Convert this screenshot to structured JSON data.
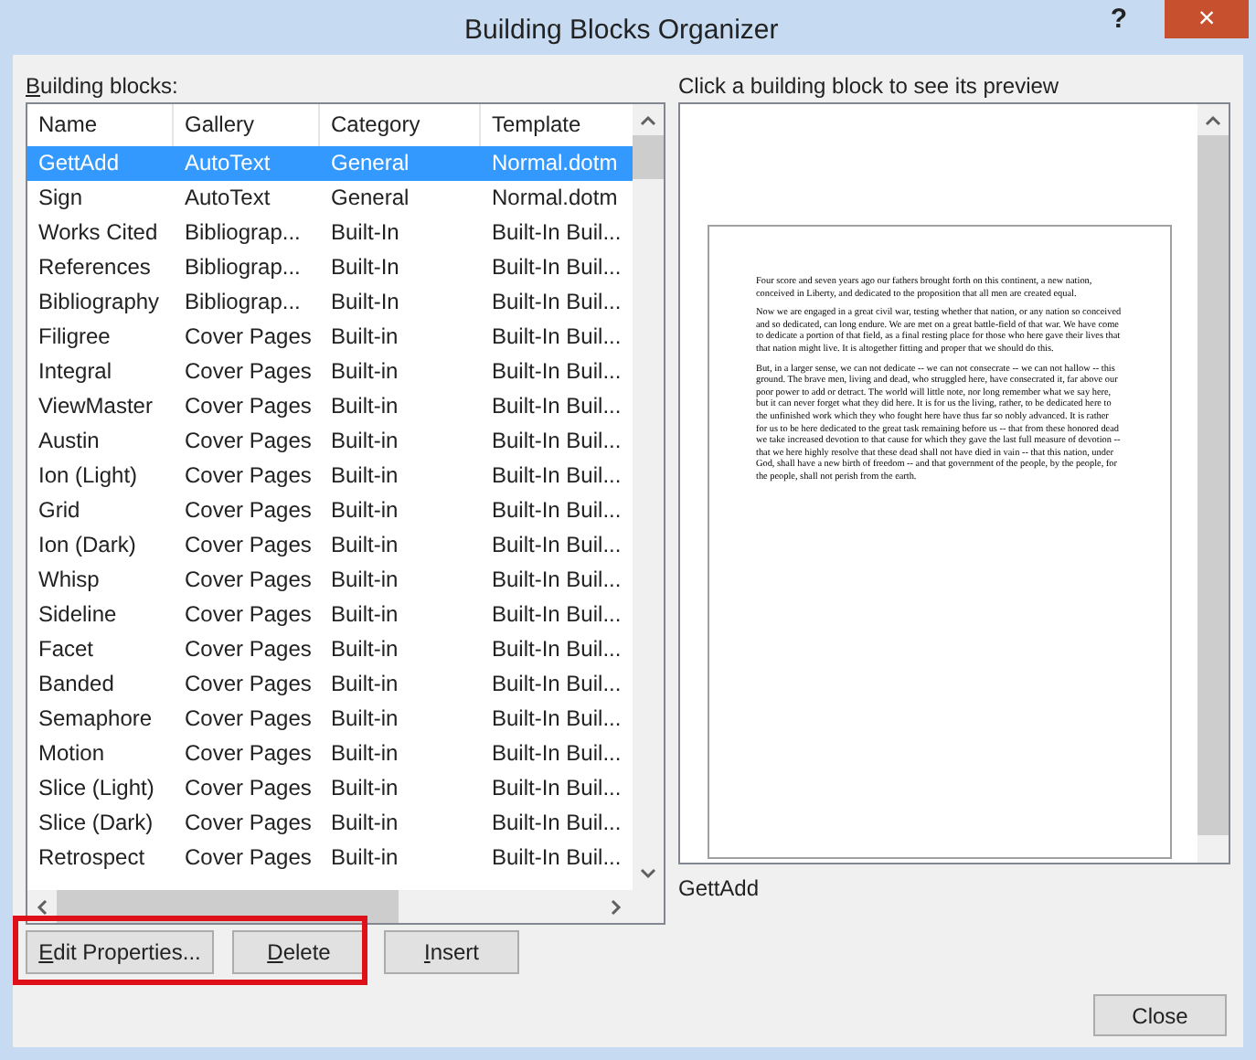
{
  "window": {
    "title": "Building Blocks Organizer",
    "help": "?",
    "close": "×"
  },
  "list_label": "Building blocks:",
  "table": {
    "columns": [
      "Name",
      "Gallery",
      "Category",
      "Template"
    ],
    "rows": [
      {
        "name": "GettAdd",
        "gallery": "AutoText",
        "category": "General",
        "template": "Normal.dotm",
        "selected": true
      },
      {
        "name": "Sign",
        "gallery": "AutoText",
        "category": "General",
        "template": "Normal.dotm",
        "selected": false
      },
      {
        "name": "Works Cited",
        "gallery": "Bibliograp...",
        "category": "Built-In",
        "template": "Built-In Buil...",
        "selected": false
      },
      {
        "name": "References",
        "gallery": "Bibliograp...",
        "category": "Built-In",
        "template": "Built-In Buil...",
        "selected": false
      },
      {
        "name": "Bibliography",
        "gallery": "Bibliograp...",
        "category": "Built-In",
        "template": "Built-In Buil...",
        "selected": false
      },
      {
        "name": "Filigree",
        "gallery": "Cover Pages",
        "category": "Built-in",
        "template": "Built-In Buil...",
        "selected": false
      },
      {
        "name": "Integral",
        "gallery": "Cover Pages",
        "category": "Built-in",
        "template": "Built-In Buil...",
        "selected": false
      },
      {
        "name": "ViewMaster",
        "gallery": "Cover Pages",
        "category": "Built-in",
        "template": "Built-In Buil...",
        "selected": false
      },
      {
        "name": "Austin",
        "gallery": "Cover Pages",
        "category": "Built-in",
        "template": "Built-In Buil...",
        "selected": false
      },
      {
        "name": "Ion (Light)",
        "gallery": "Cover Pages",
        "category": "Built-in",
        "template": "Built-In Buil...",
        "selected": false
      },
      {
        "name": "Grid",
        "gallery": "Cover Pages",
        "category": "Built-in",
        "template": "Built-In Buil...",
        "selected": false
      },
      {
        "name": "Ion (Dark)",
        "gallery": "Cover Pages",
        "category": "Built-in",
        "template": "Built-In Buil...",
        "selected": false
      },
      {
        "name": "Whisp",
        "gallery": "Cover Pages",
        "category": "Built-in",
        "template": "Built-In Buil...",
        "selected": false
      },
      {
        "name": "Sideline",
        "gallery": "Cover Pages",
        "category": "Built-in",
        "template": "Built-In Buil...",
        "selected": false
      },
      {
        "name": "Facet",
        "gallery": "Cover Pages",
        "category": "Built-in",
        "template": "Built-In Buil...",
        "selected": false
      },
      {
        "name": "Banded",
        "gallery": "Cover Pages",
        "category": "Built-in",
        "template": "Built-In Buil...",
        "selected": false
      },
      {
        "name": "Semaphore",
        "gallery": "Cover Pages",
        "category": "Built-in",
        "template": "Built-In Buil...",
        "selected": false
      },
      {
        "name": "Motion",
        "gallery": "Cover Pages",
        "category": "Built-in",
        "template": "Built-In Buil...",
        "selected": false
      },
      {
        "name": "Slice (Light)",
        "gallery": "Cover Pages",
        "category": "Built-in",
        "template": "Built-In Buil...",
        "selected": false
      },
      {
        "name": "Slice (Dark)",
        "gallery": "Cover Pages",
        "category": "Built-in",
        "template": "Built-In Buil...",
        "selected": false
      },
      {
        "name": "Retrospect",
        "gallery": "Cover Pages",
        "category": "Built-in",
        "template": "Built-In Buil...",
        "selected": false
      }
    ]
  },
  "buttons": [
    {
      "label": "Edit Properties...",
      "highlighted": true
    },
    {
      "label": "Delete",
      "highlighted": true
    },
    {
      "label": "Insert",
      "highlighted": false
    }
  ],
  "preview": {
    "label": "Click a building block to see its preview",
    "paragraphs": [
      "Four score and seven years ago our fathers brought forth on this continent, a new nation, conceived in Liberty, and dedicated to the proposition that all men are created equal.",
      "Now we are engaged in a great civil war, testing whether that nation, or any nation so conceived and so dedicated, can long endure. We are met on a great battle-field of that war. We have come to dedicate a portion of that field, as a final resting place for those who here gave their lives that that nation might live. It is altogether fitting and proper that we should do this.",
      "But, in a larger sense, we can not dedicate -- we can not consecrate -- we can not hallow -- this ground. The brave men, living and dead, who struggled here, have consecrated it, far above our poor power to add or detract. The world will little note, nor long remember what we say here, but it can never forget what they did here. It is for us the living, rather, to be dedicated here to the unfinished work which they who fought here have thus far so nobly advanced. It is rather for us to be here dedicated to the great task remaining before us -- that from these honored dead we take increased devotion to that cause for which they gave the last full measure of devotion -- that we here highly resolve that these dead shall not have died in vain -- that this nation, under God, shall have a new birth of freedom -- and that government of the people, by the people, for the people, shall not perish from the earth."
    ],
    "caption": "GettAdd"
  },
  "close_button": "Close"
}
